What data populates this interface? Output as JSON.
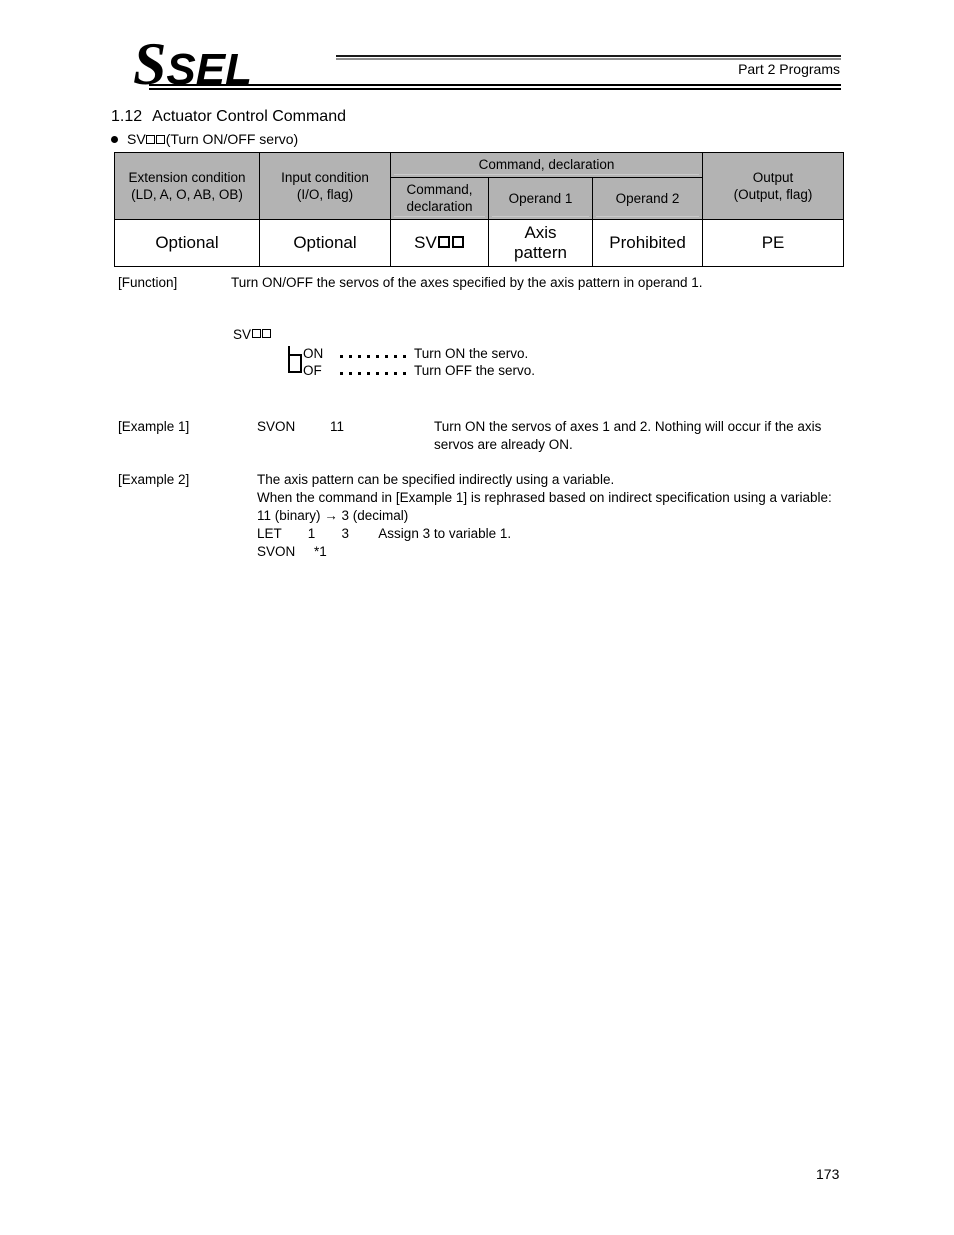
{
  "header": {
    "logo_s": "S",
    "logo_sel": "SEL",
    "part_label": "Part 2 Programs"
  },
  "section": {
    "number": "1.12",
    "title": "Actuator Control Command",
    "bullet_prefix": "SV",
    "bullet_suffix": " (Turn ON/OFF servo)"
  },
  "table": {
    "group_header": "Command, declaration",
    "columns": [
      {
        "line1": "Extension condition",
        "line2": "(LD, A, O, AB, OB)"
      },
      {
        "line1": "Input condition",
        "line2": "(I/O, flag)"
      },
      {
        "line1": "Command,",
        "line2": "declaration"
      },
      {
        "line1": "Operand 1",
        "line2": ""
      },
      {
        "line1": "Operand 2",
        "line2": ""
      },
      {
        "line1": "Output",
        "line2": "(Output, flag)"
      }
    ],
    "values": {
      "extension_condition": "Optional",
      "input_condition": "Optional",
      "command_declaration_prefix": "SV",
      "operand1_line1": "Axis",
      "operand1_line2": "pattern",
      "operand2": "Prohibited",
      "output": "PE"
    }
  },
  "function": {
    "label": "[Function]",
    "text": "Turn ON/OFF the servos of the axes specified by the axis pattern in operand 1."
  },
  "tree": {
    "root_prefix": "SV",
    "option_on": "ON",
    "option_of": "OF",
    "desc_on": "Turn ON the servo.",
    "desc_of": "Turn OFF the servo."
  },
  "example1": {
    "label": "[Example 1]",
    "command": "SVON",
    "argument": "11",
    "description": "Turn ON the servos of axes 1 and 2. Nothing will occur if the axis servos are already ON."
  },
  "example2": {
    "label": "[Example 2]",
    "line1": "The axis pattern can be specified indirectly using a variable.",
    "line2": "When the command in [Example 1] is rephrased based on indirect specification using a variable:",
    "line3": "11 (binary) → 3 (decimal)",
    "code_line1": "LET       1       3        Assign 3 to variable 1.",
    "code_line2": "SVON     *1"
  },
  "footer": {
    "page_number": "173"
  }
}
